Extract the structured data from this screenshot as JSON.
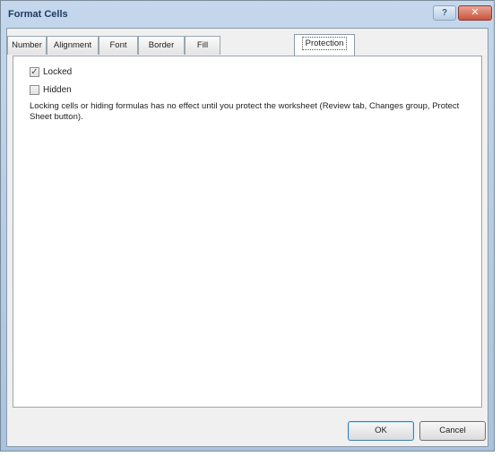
{
  "window": {
    "title": "Format Cells",
    "help_glyph": "?",
    "close_glyph": "✕"
  },
  "tabs": [
    {
      "label": "Number"
    },
    {
      "label": "Alignment"
    },
    {
      "label": "Font"
    },
    {
      "label": "Border"
    },
    {
      "label": "Fill"
    },
    {
      "label": "Protection",
      "active": true
    }
  ],
  "protection": {
    "locked": {
      "label": "Locked",
      "checked": true,
      "mark": "✓"
    },
    "hidden": {
      "label": "Hidden",
      "checked": false,
      "mark": ""
    },
    "note": "Locking cells or hiding formulas has no effect until you protect the worksheet (Review tab, Changes group, Protect Sheet button)."
  },
  "buttons": {
    "ok": "OK",
    "cancel": "Cancel"
  }
}
